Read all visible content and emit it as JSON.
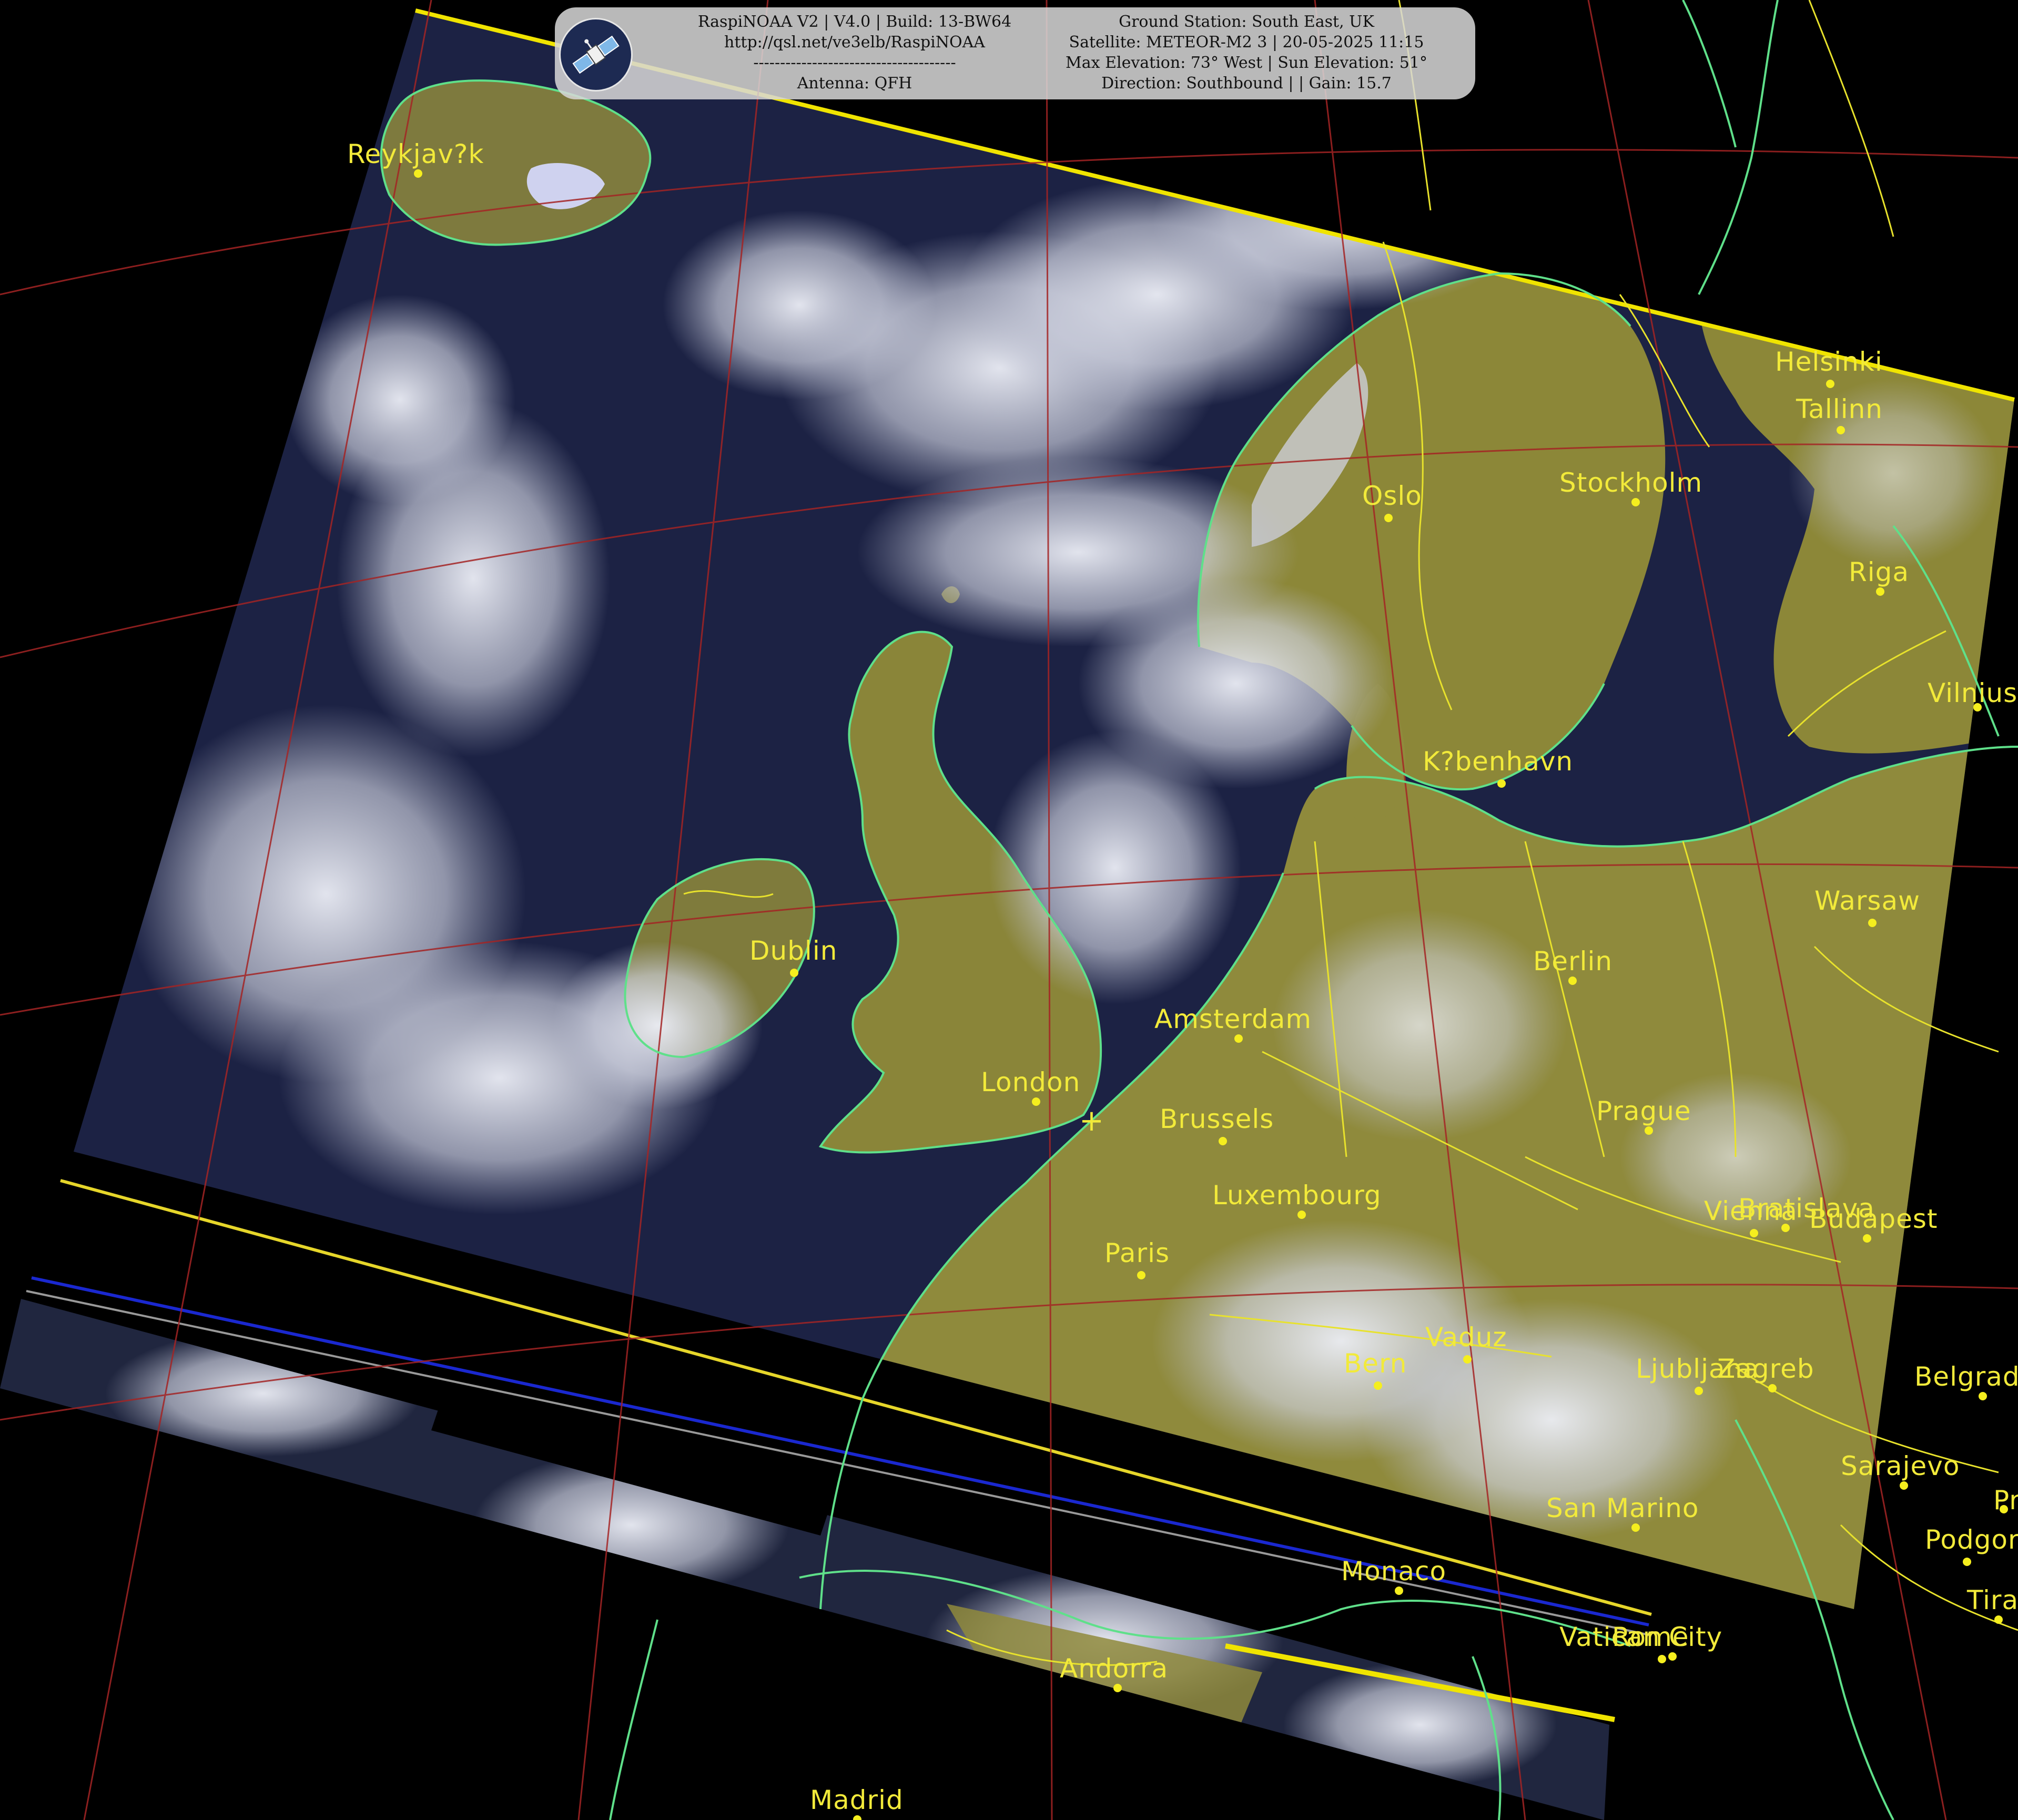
{
  "info": {
    "left_lines": [
      "RaspiNOAA V2 | V4.0 | Build: 13-BW64",
      "http://qsl.net/ve3elb/RaspiNOAA",
      "--------------------------------------",
      "Antenna: QFH"
    ],
    "right_lines": [
      "Ground Station: South East, UK",
      "Satellite: METEOR-M2 3 | 20-05-2025 11:15",
      "Max Elevation: 73° West | Sun Elevation: 51°",
      "Direction: Southbound | | Gain: 15.7"
    ],
    "logo_icon": "satellite-icon"
  },
  "cities": [
    {
      "name": "Reykjav?k"
    },
    {
      "name": "Helsinki"
    },
    {
      "name": "Tallinn"
    },
    {
      "name": "Oslo"
    },
    {
      "name": "Stockholm"
    },
    {
      "name": "Riga"
    },
    {
      "name": "Vilnius"
    },
    {
      "name": "K?benhavn"
    },
    {
      "name": "Warsaw"
    },
    {
      "name": "Dublin"
    },
    {
      "name": "Berlin"
    },
    {
      "name": "Amsterdam"
    },
    {
      "name": "London"
    },
    {
      "name": "Brussels"
    },
    {
      "name": "Prague"
    },
    {
      "name": "Luxembourg"
    },
    {
      "name": "Bratislava"
    },
    {
      "name": "Vienna"
    },
    {
      "name": "Budapest"
    },
    {
      "name": "Paris"
    },
    {
      "name": "Vaduz"
    },
    {
      "name": "Bern"
    },
    {
      "name": "Ljubljana"
    },
    {
      "name": "Zagreb"
    },
    {
      "name": "Belgrade"
    },
    {
      "name": "Sarajevo"
    },
    {
      "name": "Pr"
    },
    {
      "name": "San Marino"
    },
    {
      "name": "Podgorica"
    },
    {
      "name": "Monaco"
    },
    {
      "name": "Tirana"
    },
    {
      "name": "Rome"
    },
    {
      "name": "Vatican City"
    },
    {
      "name": "Andorra"
    },
    {
      "name": "Madrid"
    }
  ],
  "colors": {
    "land": "#8f8a3c",
    "sea": "#1c2244",
    "cloud": "#d9dbe8",
    "coast": "#5fe08a",
    "border": "#e8e22c",
    "grid": "#a42424",
    "label": "#f2ea3a",
    "background": "#000000"
  }
}
